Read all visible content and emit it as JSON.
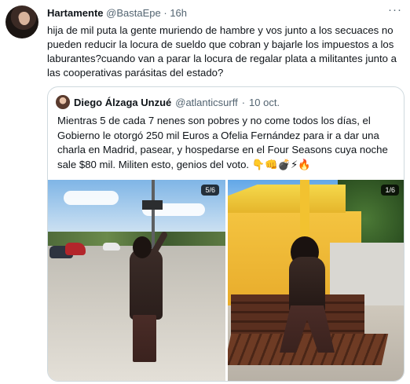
{
  "tweet": {
    "author_name": "Hartamente",
    "author_handle": "@BastaEpe",
    "separator": "·",
    "time": "16h",
    "more_icon": "more-dots-icon",
    "text": "hija de mil puta la gente muriendo de  hambre y vos junto a los secuaces no pueden reducir la locura de sueldo que cobran y bajarle los impuestos a los laburantes?cuando van a parar la locura de regalar plata a militantes junto a las cooperativas parásitas del estado?"
  },
  "quoted": {
    "author_name": "Diego Álzaga Unzué",
    "author_handle": "@atlanticsurff",
    "separator": "·",
    "date": "10 oct.",
    "text": "Mientras 5 de cada 7 nenes son pobres y no come todos los días, el Gobierno le otorgó 250 mil Euros a Ofelia Fernández para ir a dar una charla en Madrid, pasear, y hospedarse en el Four Seasons cuya noche sale $80 mil. Militen esto, genios del voto. 👇👊💣⚡🔥",
    "media": [
      {
        "badge": "5/6"
      },
      {
        "badge": "1/6"
      }
    ]
  }
}
